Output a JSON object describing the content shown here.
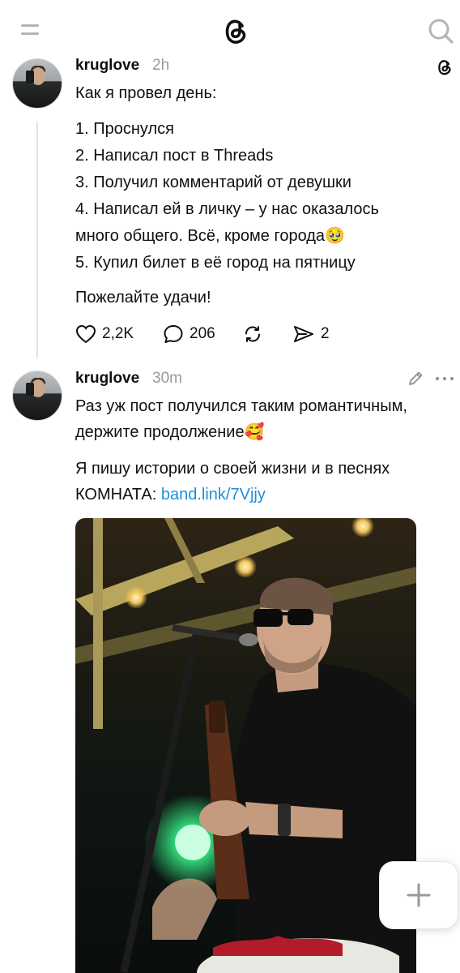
{
  "posts": [
    {
      "username": "kruglove",
      "time": "2h",
      "lines": [
        "Как я провел день:",
        "1. Проснулся",
        "2. Написал пост в Threads",
        "3. Получил комментарий от девушки",
        "4. Написал ей в личку – у нас оказалось",
        "много общего. Всё, кроме города🥹",
        "5. Купил билет в её город на пятницу",
        "Пожелайте удачи!"
      ],
      "likes": "2,2K",
      "replies": "206",
      "shares": "2"
    },
    {
      "username": "kruglove",
      "time": "30m",
      "lines": [
        "Раз уж пост получился таким романтичным,",
        "держите продолжение🥰",
        "Я пишу истории о своей жизни и в песнях",
        "КОМНАТА: "
      ],
      "link_text": "band.link/7Vjjy"
    }
  ],
  "icons": {
    "menu": "menu-icon",
    "logo": "threads-logo-icon",
    "search": "search-icon",
    "like": "heart-icon",
    "reply": "comment-icon",
    "repost": "repost-icon",
    "share": "send-icon",
    "edit": "pencil-icon",
    "more": "more-icon",
    "new_post": "plus-icon"
  },
  "colors": {
    "link": "#1f8fd9",
    "meta": "#9a9a9a",
    "stage_light": "#31d87a"
  }
}
